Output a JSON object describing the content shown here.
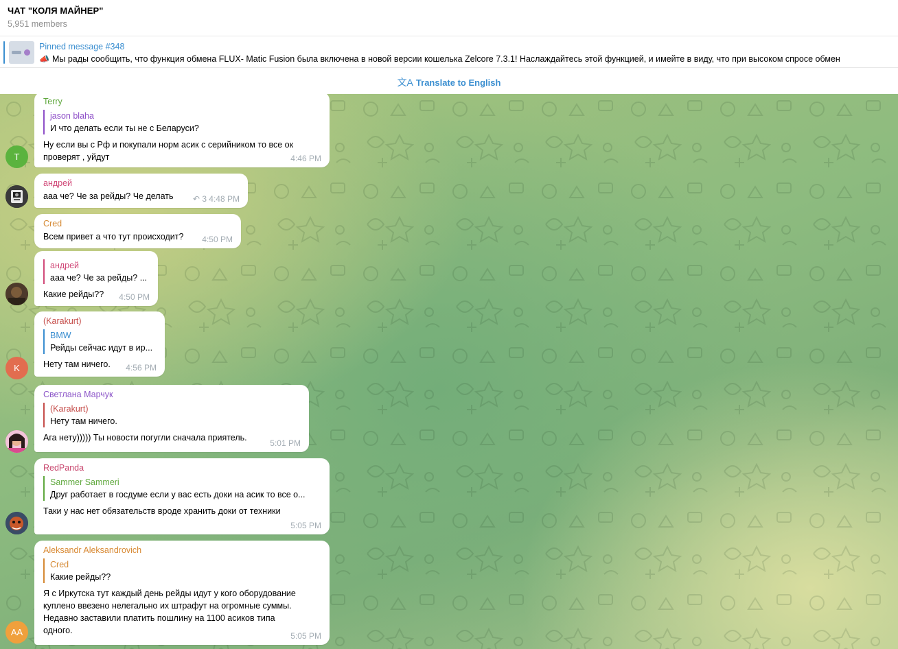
{
  "header": {
    "title": "ЧАТ \"КОЛЯ МАЙНЕР\"",
    "subtitle": "5,951 members"
  },
  "pinned": {
    "title": "Pinned message #348",
    "text": "Мы рады сообщить, что функция обмена FLUX- Matic Fusion была включена в новой версии кошелька Zelcore 7.3.1! Наслаждайтесь этой функцией, и имейте в виду, что при высоком спросе обмен"
  },
  "translate": {
    "label": "Translate to English"
  },
  "colors": {
    "accent": "#3a8ed0",
    "terry": "#5fa83d",
    "andrey": "#d14a79",
    "cred": "#d58933",
    "karakurt": "#c54d4a",
    "svetlana": "#8c55c8",
    "redpanda": "#c8476e",
    "aleksandr": "#d88a35",
    "jason": "#8e4fc8",
    "bmw": "#3a8ed0",
    "sammer": "#5fa83d"
  },
  "messages": [
    {
      "sender": "Terry",
      "quote": {
        "name": "jason blaha",
        "text": "И что делать если ты не с Беларуси?"
      },
      "lines": [
        "Ну если вы с Рф и покупали норм асик с серийником то все ок",
        "проверят , уйдут"
      ],
      "time": "4:46 PM",
      "avatar": {
        "initials": "T",
        "color": "#5bb33e",
        "kind": "letter"
      }
    },
    {
      "sender": "андрей",
      "lines": [
        "ааа че? Че за рейды? Че делать"
      ],
      "replies": "3",
      "time": "4:48 PM",
      "avatar": {
        "kind": "photo-camera"
      }
    },
    {
      "sender": "Cred",
      "lines": [
        "Всем привет а что тут происходит?"
      ],
      "time": "4:50 PM"
    },
    {
      "sender": "",
      "quote": {
        "name": "андрей",
        "text": "ааа че? Че за рейды? ..."
      },
      "lines": [
        "Какие рейды??"
      ],
      "time": "4:50 PM",
      "avatar": {
        "kind": "photo-dark"
      }
    },
    {
      "sender": "(Karakurt)",
      "quote": {
        "name": "BMW",
        "text": "Рейды сейчас идут в ир..."
      },
      "lines": [
        "Нету там ничего."
      ],
      "time": "4:56 PM",
      "avatar": {
        "initials": "K",
        "color": "#e26d4f",
        "kind": "letter"
      }
    },
    {
      "sender": "Светлана Марчук",
      "quote": {
        "name": "(Karakurt)",
        "text": "Нету там ничего."
      },
      "lines": [
        "Ага нету))))) Ты новости погугли сначала приятель."
      ],
      "time": "5:01 PM",
      "avatar": {
        "kind": "photo-pink"
      }
    },
    {
      "sender": "RedPanda",
      "quote": {
        "name": "Sammer Sammeri",
        "text": "Друг работает в госдуме если у вас есть доки на асик то все о..."
      },
      "lines": [
        "Таки у нас нет обязательств вроде хранить доки от техники"
      ],
      "time": "5:05 PM",
      "avatar": {
        "kind": "photo-panda"
      }
    },
    {
      "sender": "Aleksandr Aleksandrovich",
      "quote": {
        "name": "Cred",
        "text": "Какие рейды??"
      },
      "lines": [
        "Я с Иркутска тут каждый день рейды идут у кого оборудование",
        "куплено ввезено нелегально их штрафут на огромные суммы.",
        "Недавно заставили платить пошлину на 1100 асиков типа",
        "одного."
      ],
      "time": "5:05 PM",
      "avatar": {
        "initials": "AA",
        "color": "#f0a03c",
        "kind": "letter"
      }
    }
  ]
}
